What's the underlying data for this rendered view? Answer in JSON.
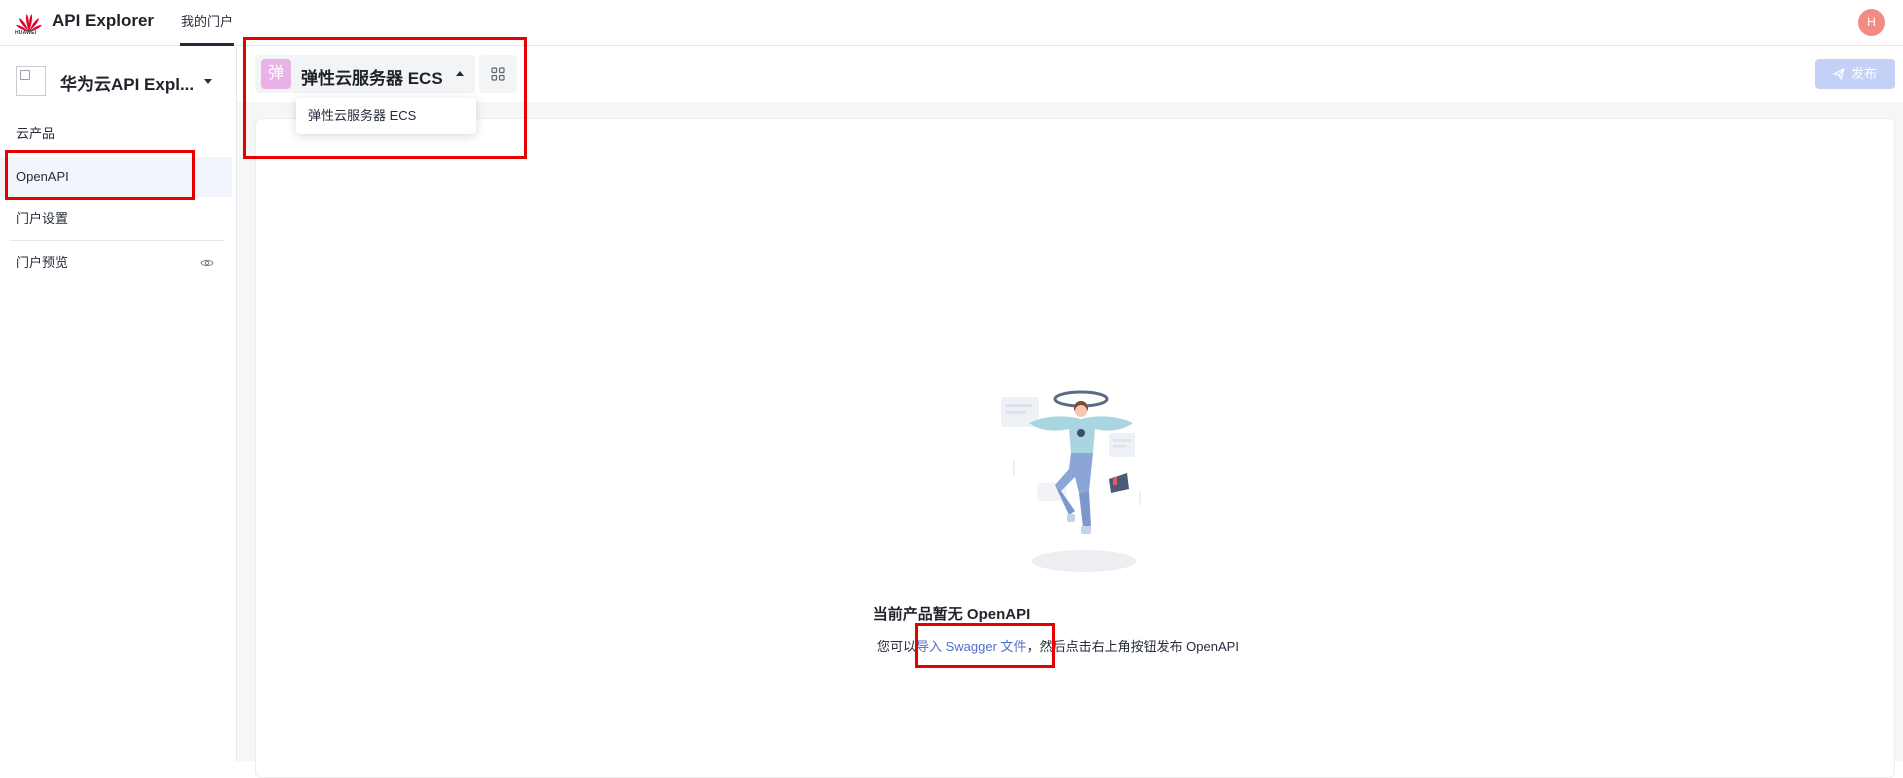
{
  "header": {
    "logo_text": "HUAWEI",
    "app_title": "API Explorer",
    "nav": [
      "我的门户"
    ],
    "avatar_initial": "H"
  },
  "sidebar": {
    "portal_name": "华为云API Expl...",
    "items": [
      {
        "label": "云产品"
      },
      {
        "label": "OpenAPI"
      },
      {
        "label": "门户设置"
      },
      {
        "label": "门户预览"
      }
    ]
  },
  "product": {
    "badge": "弹",
    "name": "弹性云服务器 ECS",
    "dropdown_option": "弹性云服务器 ECS"
  },
  "toolbar": {
    "publish_label": "发布"
  },
  "empty_state": {
    "title": "当前产品暂无 OpenAPI",
    "desc_prefix": "您可以",
    "link_text": "导入 Swagger 文件",
    "desc_suffix": "，然后点击右上角按钮发布 OpenAPI"
  },
  "colors": {
    "accent": "#526ecc",
    "badge": "#e9b2e6",
    "avatar": "#f28b82",
    "annotation": "#e60000",
    "publish_disabled": "#c5d0f6"
  }
}
